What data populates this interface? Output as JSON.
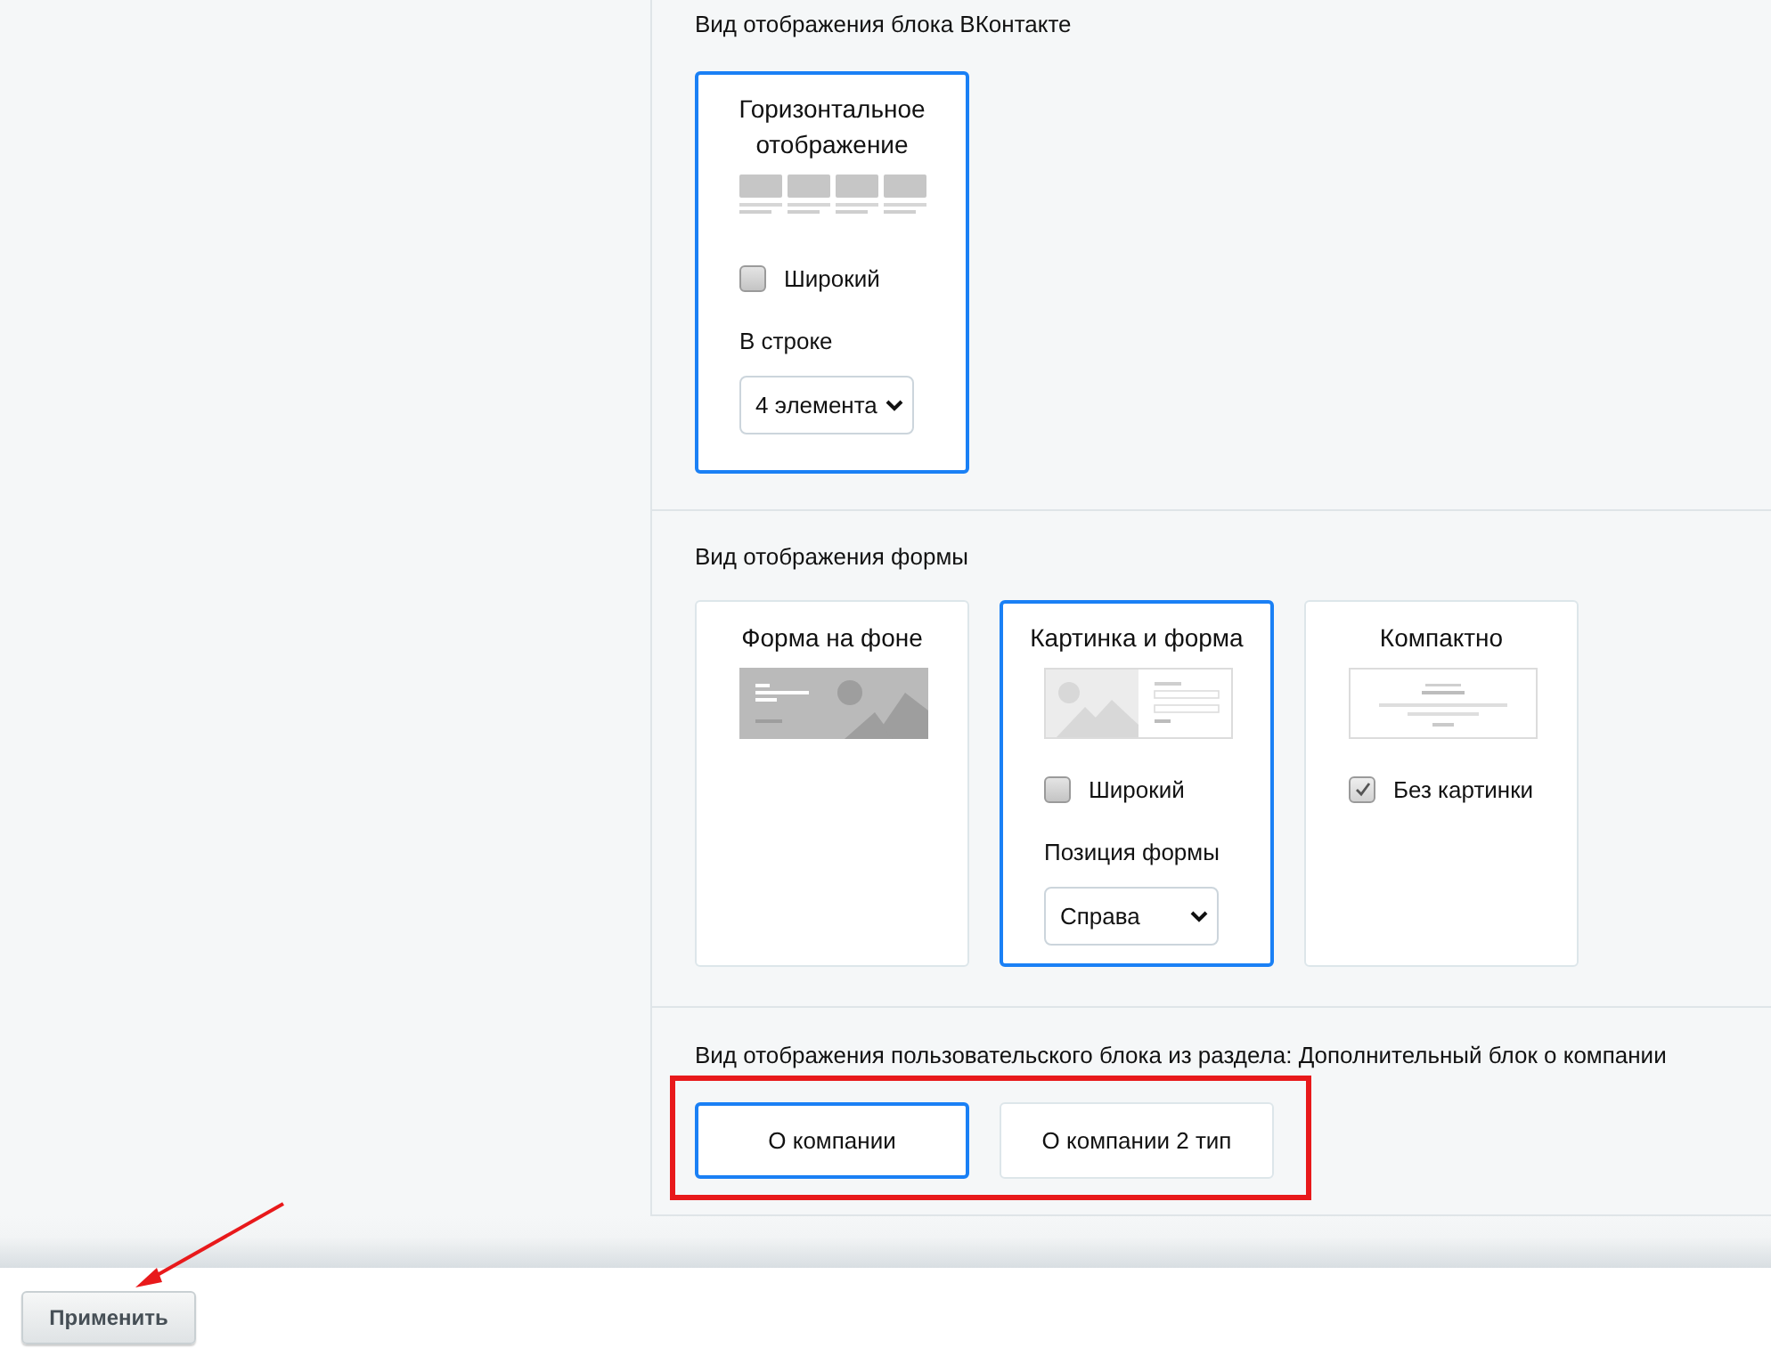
{
  "sections": [
    {
      "title": "Вид отображения блока ВКонтакте",
      "kind": "cards",
      "options": [
        {
          "label": "Горизонтальное отображение",
          "selected": true,
          "kind": "tiles",
          "controls": [
            {
              "kind": "checkbox",
              "label": "Широкий",
              "checked": false
            },
            {
              "kind": "select",
              "label": "В строке",
              "value": "4 элемента"
            }
          ]
        }
      ]
    },
    {
      "title": "Вид отображения формы",
      "kind": "cards",
      "options": [
        {
          "label": "Форма на фоне",
          "selected": false,
          "kind": "background-form"
        },
        {
          "label": "Картинка и форма",
          "selected": true,
          "kind": "image-form",
          "controls": [
            {
              "kind": "checkbox",
              "label": "Широкий",
              "checked": false
            },
            {
              "kind": "select",
              "label": "Позиция формы",
              "value": "Справа"
            }
          ]
        },
        {
          "label": "Компактно",
          "selected": false,
          "kind": "compact",
          "controls": [
            {
              "kind": "checkbox",
              "label": "Без картинки",
              "checked": true
            }
          ]
        }
      ]
    },
    {
      "title": "Вид отображения пользовательского блока из раздела: Дополнительный блок о компании",
      "kind": "buttons",
      "options": [
        {
          "label": "О компании",
          "selected": true
        },
        {
          "label": "О компании 2 тип",
          "selected": false
        }
      ]
    }
  ],
  "apply_button": "Применить"
}
